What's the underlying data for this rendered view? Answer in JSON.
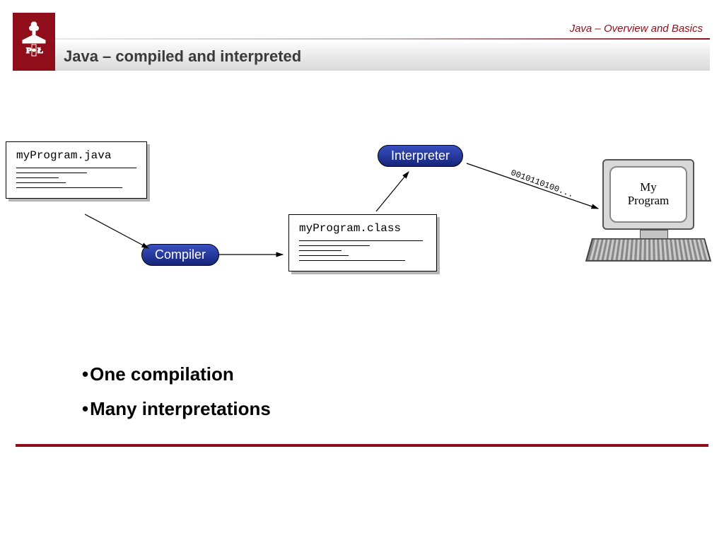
{
  "header": {
    "breadcrumb": "Java – Overview and Basics",
    "title": "Java – compiled and interpreted"
  },
  "diagram": {
    "source_file": "myProgram.java",
    "compiler_label": "Compiler",
    "class_file": "myProgram.class",
    "interpreter_label": "Interpreter",
    "bytecode_stream": "0010110100...",
    "program_output": "My\nProgram"
  },
  "bullets": [
    "One compilation",
    "Many interpretations"
  ]
}
